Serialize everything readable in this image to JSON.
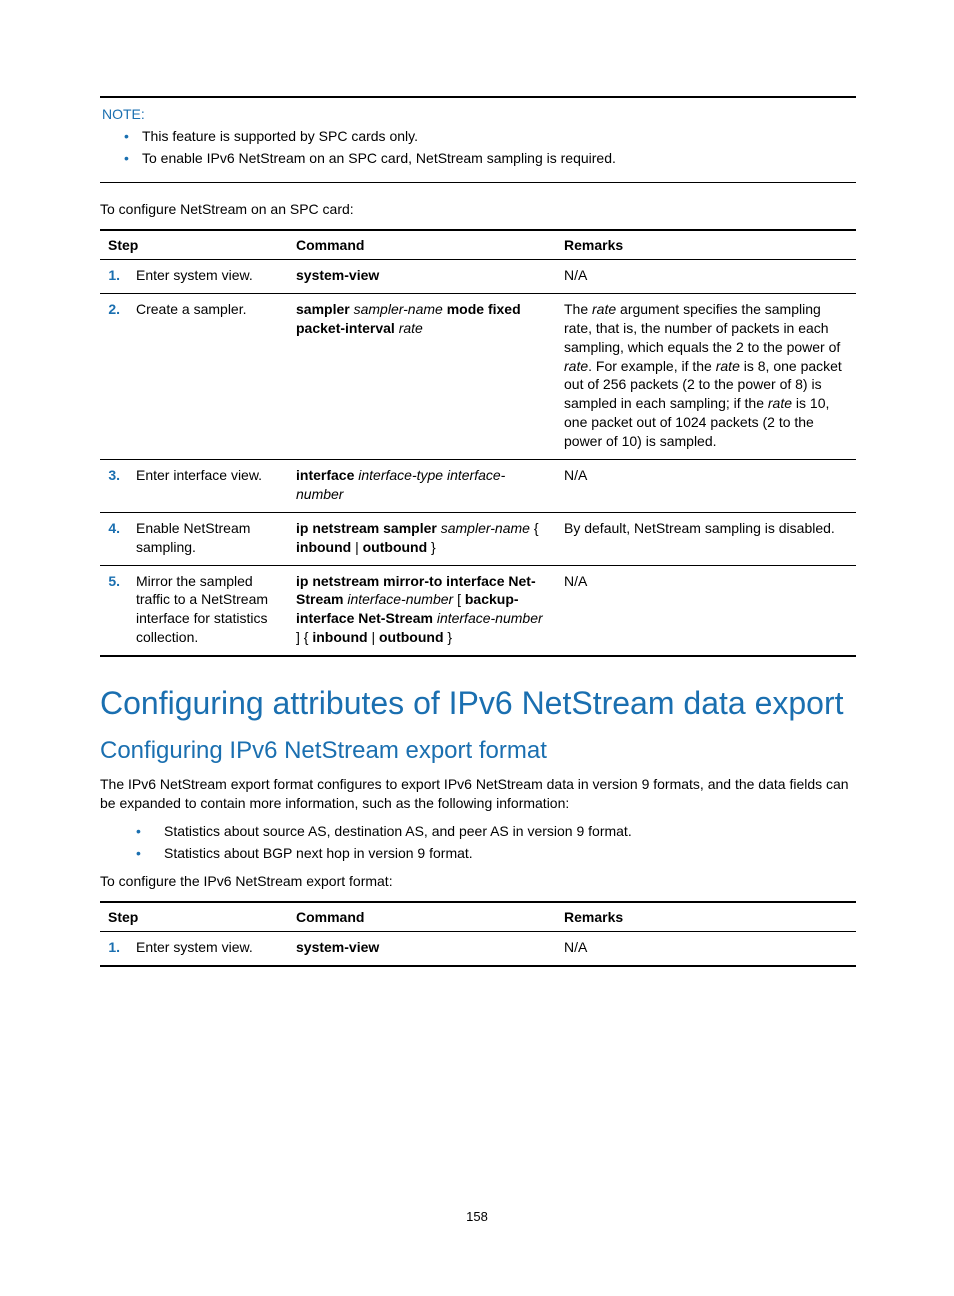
{
  "note": {
    "label": "NOTE:",
    "items": [
      "This feature is supported by SPC cards only.",
      "To enable IPv6 NetStream on an SPC card, NetStream sampling is required."
    ]
  },
  "intro1": "To configure NetStream on an SPC card:",
  "table1": {
    "headers": {
      "step": "Step",
      "command": "Command",
      "remarks": "Remarks"
    },
    "rows": [
      {
        "num": "1.",
        "step": "Enter system view.",
        "cmd": {
          "t1": "system-view"
        },
        "rem": {
          "t1": "N/A"
        }
      },
      {
        "num": "2.",
        "step": "Create a sampler.",
        "cmd": {
          "t1": "sampler",
          "t2": " sampler-name ",
          "t3": "mode fixed packet-interval",
          "t4": " rate"
        },
        "rem": {
          "p1": "The ",
          "i1": "rate",
          "p2": " argument specifies the sampling rate, that is, the number of packets in each sampling, which equals the 2 to the power of ",
          "i2": "rate",
          "p3": ". For example, if the ",
          "i3": "rate",
          "p4": " is 8, one packet out of 256 packets (2 to the power of 8) is sampled in each sampling; if the ",
          "i4": "rate",
          "p5": " is 10, one packet out of 1024 packets (2 to the power of 10) is sampled."
        }
      },
      {
        "num": "3.",
        "step": "Enter interface view.",
        "cmd": {
          "t1": "interface",
          "t2": " interface-type interface-number"
        },
        "rem": {
          "t1": "N/A"
        }
      },
      {
        "num": "4.",
        "step": "Enable NetStream sampling.",
        "cmd": {
          "t1": "ip netstream sampler",
          "t2": " sampler-name ",
          "t3": "{ ",
          "t4": "inbound",
          "t5": " | ",
          "t6": "outbound",
          "t7": " }"
        },
        "rem": {
          "t1": "By default, NetStream sampling is disabled."
        }
      },
      {
        "num": "5.",
        "step": "Mirror the sampled traffic to a NetStream interface for statistics collection.",
        "cmd": {
          "t1": "ip netstream mirror-to interface Net-Stream",
          "t2": " interface-number",
          "t3": " [ ",
          "t4": "backup-interface Net-Stream",
          "t5": " interface-number",
          "t6": " ] { ",
          "t7": "inbound",
          "t8": " | ",
          "t9": "outbound",
          "t10": " }"
        },
        "rem": {
          "t1": "N/A"
        }
      }
    ]
  },
  "h1": "Configuring attributes of IPv6 NetStream data export",
  "h2": "Configuring IPv6 NetStream export format",
  "para1": "The IPv6 NetStream export format configures to export IPv6 NetStream data in version 9 formats, and the data fields can be expanded to contain more information, such as the following information:",
  "bullets": [
    "Statistics about source AS, destination AS, and peer AS in version 9 format.",
    "Statistics about BGP next hop in version 9 format."
  ],
  "intro2": "To configure the IPv6 NetStream export format:",
  "table2": {
    "headers": {
      "step": "Step",
      "command": "Command",
      "remarks": "Remarks"
    },
    "rows": [
      {
        "num": "1.",
        "step": "Enter system view.",
        "cmd": {
          "t1": "system-view"
        },
        "rem": {
          "t1": "N/A"
        }
      }
    ]
  },
  "pagenum": "158"
}
